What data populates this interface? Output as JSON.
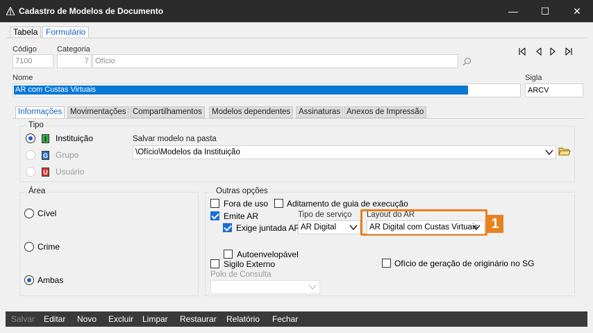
{
  "window": {
    "title": "Cadastro de Modelos de Documento",
    "minimize": "—",
    "maximize": "☐",
    "close": "✕"
  },
  "top_tabs": [
    "Tabela",
    "Formulário"
  ],
  "header": {
    "codigo_label": "Código",
    "codigo_value": "7100",
    "categoria_label": "Categoria",
    "categoria_num": "7",
    "categoria_name": "Ofício",
    "nome_label": "Nome",
    "nome_value": "AR com Custas Virtuais",
    "sigla_label": "Sigla",
    "sigla_value": "ARCV"
  },
  "inner_tabs": [
    "Informações",
    "Movimentações",
    "Compartilhamentos",
    "Modelos dependentes",
    "Assinaturas",
    "Anexos de Impressão"
  ],
  "tipo": {
    "title": "Tipo",
    "options": [
      {
        "label": "Instituição",
        "badge": "I",
        "badge_color": "#2ea84a",
        "selected": true,
        "enabled": true
      },
      {
        "label": "Grupo",
        "badge": "G",
        "badge_color": "#2f6fc9",
        "selected": false,
        "enabled": false
      },
      {
        "label": "Usuário",
        "badge": "U",
        "badge_color": "#d8342c",
        "selected": false,
        "enabled": false
      }
    ],
    "pasta_label": "Salvar modelo na pasta",
    "pasta_value": "\\Ofício\\Modelos da Instituição"
  },
  "area": {
    "title": "Área",
    "options": [
      {
        "label": "Cível",
        "selected": false
      },
      {
        "label": "Crime",
        "selected": false
      },
      {
        "label": "Ambas",
        "selected": true
      }
    ]
  },
  "outras": {
    "title": "Outras opções",
    "fora_de_uso": "Fora de uso",
    "aditamento": "Aditamento de guia de execução",
    "emite_ar": "Emite AR",
    "exige_juntada": "Exige juntada AR",
    "tipo_servico_label": "Tipo de serviço",
    "tipo_servico_value": "AR Digital",
    "layout_label": "Layout do AR",
    "layout_value": "AR Digital com Custas Virtuais",
    "autoenvelopavel": "Autoenvelopável",
    "sigilo": "Sigilo Externo",
    "oficio_geracao": "Ofício de geração de originário no SG",
    "polo_label": "Polo de Consulta",
    "polo_value": ""
  },
  "callout": "1",
  "toolbar": [
    "Salvar",
    "Editar",
    "Novo",
    "Excluir",
    "Limpar",
    "Restaurar",
    "Relatório",
    "Fechar"
  ],
  "colors": {
    "accent": "#1a6fd8",
    "highlight": "#e8821e",
    "selection": "#0a78d7"
  }
}
